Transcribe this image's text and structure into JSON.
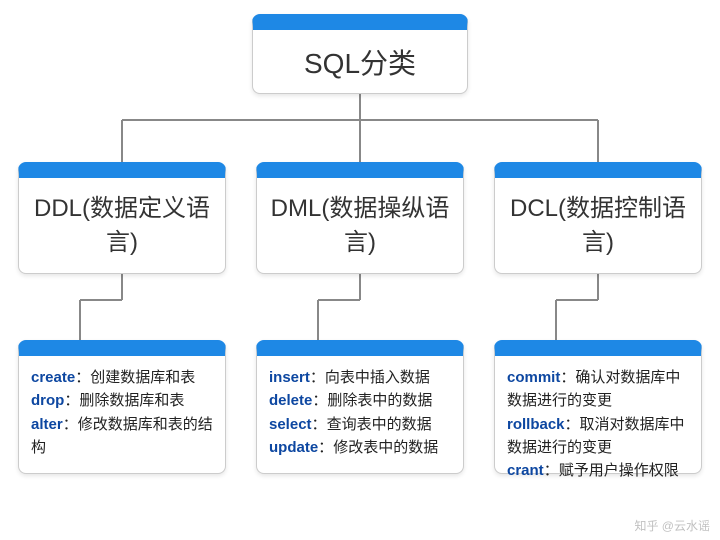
{
  "chart_data": {
    "type": "tree",
    "root": "SQL分类",
    "children": [
      {
        "label": "DDL(数据定义语言)",
        "commands": [
          {
            "keyword": "create",
            "desc": "创建数据库和表"
          },
          {
            "keyword": "drop",
            "desc": "删除数据库和表"
          },
          {
            "keyword": "alter",
            "desc": "修改数据库和表的结构"
          }
        ]
      },
      {
        "label": "DML(数据操纵语言)",
        "commands": [
          {
            "keyword": "insert",
            "desc": "向表中插入数据"
          },
          {
            "keyword": "delete",
            "desc": "删除表中的数据"
          },
          {
            "keyword": "select",
            "desc": "查询表中的数据"
          },
          {
            "keyword": "update",
            "desc": "修改表中的数据"
          }
        ]
      },
      {
        "label": "DCL(数据控制语言)",
        "commands": [
          {
            "keyword": "commit",
            "desc": "确认对数据库中数据进行的变更"
          },
          {
            "keyword": "rollback",
            "desc": "取消对数据库中数据进行的变更"
          },
          {
            "keyword": "crant",
            "desc": "赋予用户操作权限"
          }
        ]
      }
    ]
  },
  "sep": "：",
  "watermark": "知乎 @云水谣",
  "accent_color": "#1e88e5"
}
